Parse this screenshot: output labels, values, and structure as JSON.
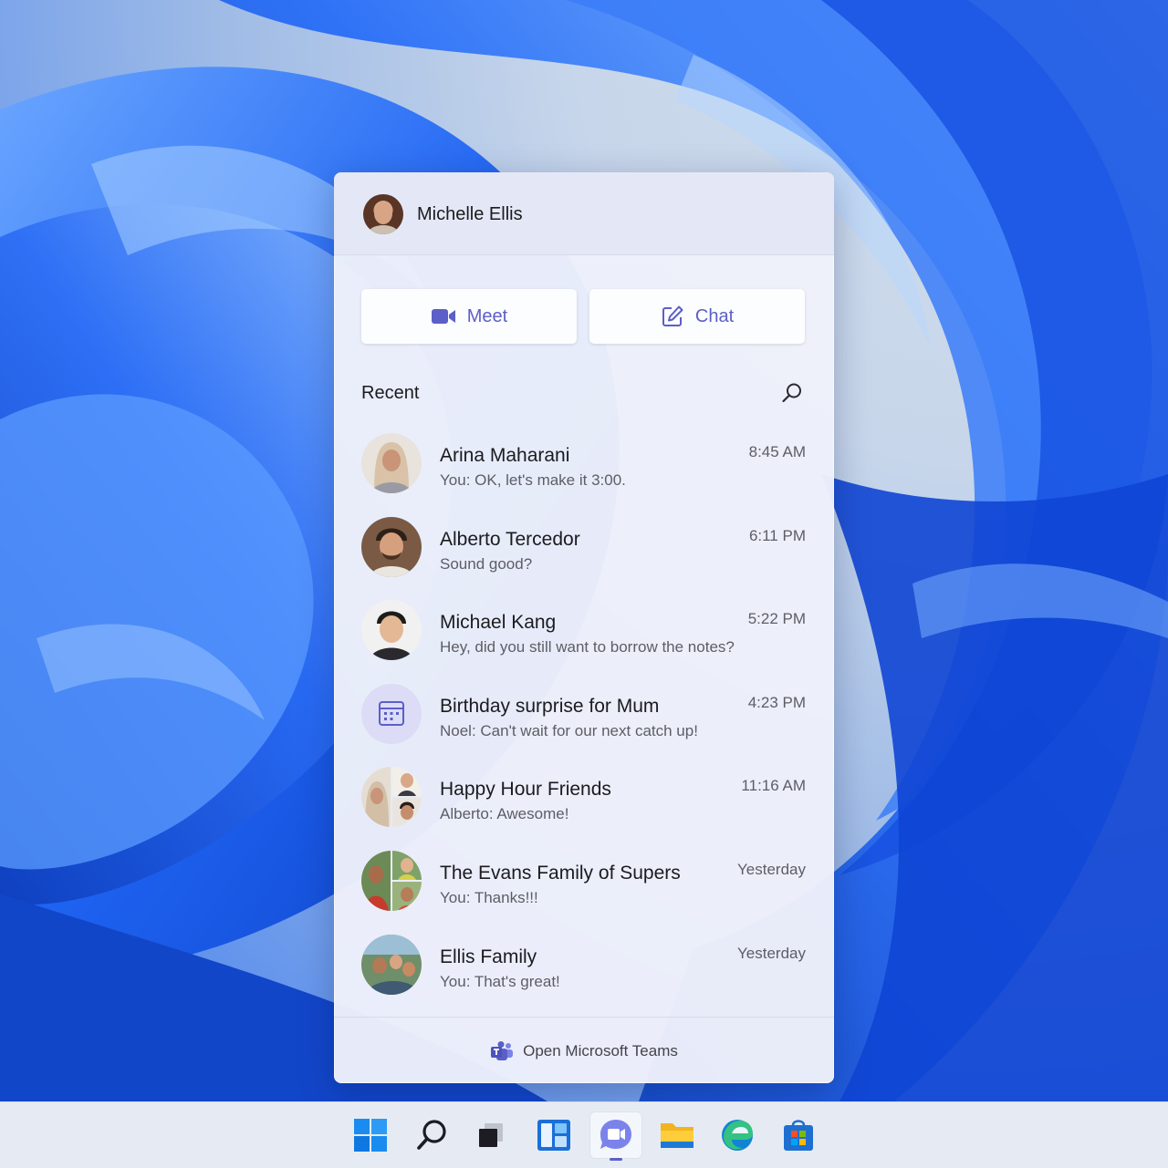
{
  "user": {
    "name": "Michelle Ellis"
  },
  "actions": {
    "meet_label": "Meet",
    "chat_label": "Chat"
  },
  "recent": {
    "label": "Recent",
    "items": [
      {
        "title": "Arina Maharani",
        "preview": "You: OK, let's make it 3:00.",
        "time": "8:45 AM",
        "avatar": "person"
      },
      {
        "title": "Alberto Tercedor",
        "preview": "Sound good?",
        "time": "6:11 PM",
        "avatar": "person"
      },
      {
        "title": "Michael Kang",
        "preview": "Hey, did you still want to borrow the notes?",
        "time": "5:22 PM",
        "avatar": "person"
      },
      {
        "title": "Birthday surprise for Mum",
        "preview": "Noel: Can't wait for our next catch up!",
        "time": "4:23 PM",
        "avatar": "calendar-icon"
      },
      {
        "title": "Happy Hour Friends",
        "preview": "Alberto: Awesome!",
        "time": "11:16 AM",
        "avatar": "group"
      },
      {
        "title": "The Evans Family of Supers",
        "preview": "You: Thanks!!!",
        "time": "Yesterday",
        "avatar": "group"
      },
      {
        "title": "Ellis Family",
        "preview": "You: That's great!",
        "time": "Yesterday",
        "avatar": "group-photo"
      }
    ]
  },
  "footer": {
    "open_teams_label": "Open Microsoft Teams"
  },
  "taskbar": {
    "items": [
      "windows-start-icon",
      "search-icon",
      "task-view-icon",
      "widgets-icon",
      "teams-chat-icon",
      "file-explorer-icon",
      "edge-icon",
      "store-icon"
    ],
    "active": "teams-chat-icon"
  },
  "colors": {
    "accent": "#5b5fc7",
    "wallpaper": "#1a5cf0"
  }
}
